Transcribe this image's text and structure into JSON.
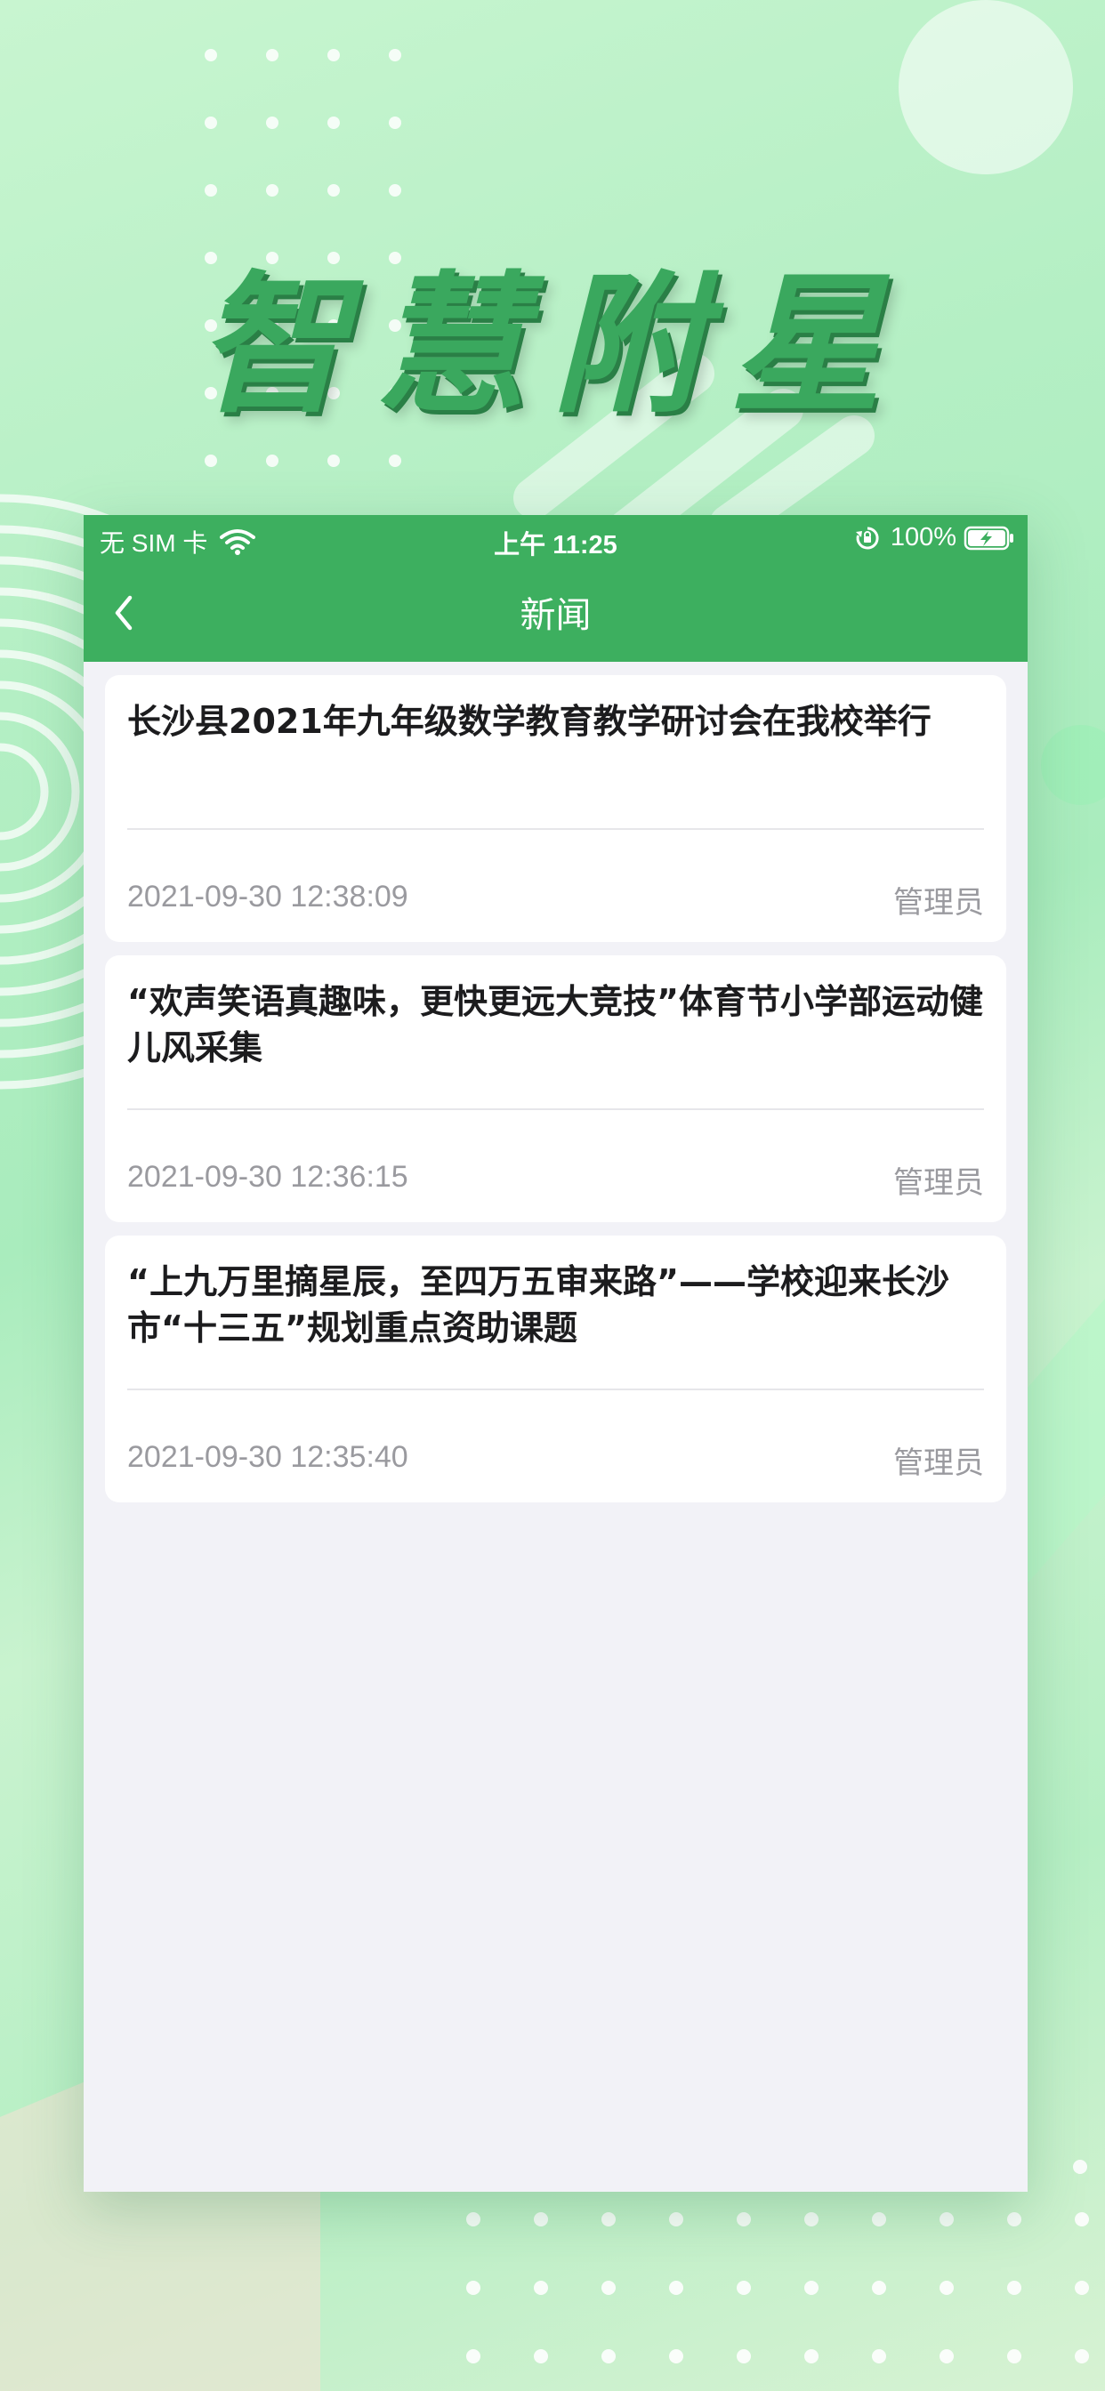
{
  "promo": {
    "title": "智慧附星"
  },
  "status_bar": {
    "carrier": "无 SIM 卡",
    "time": "上午 11:25",
    "battery": "100%"
  },
  "nav": {
    "title": "新闻"
  },
  "news": [
    {
      "title": "长沙县2021年九年级数学教育教学研讨会在我校举行",
      "date": "2021-09-30 12:38:09",
      "author": "管理员"
    },
    {
      "title": "“欢声笑语真趣味，更快更远大竞技”体育节小学部运动健儿风采集",
      "date": "2021-09-30 12:36:15",
      "author": "管理员"
    },
    {
      "title": "“上九万里摘星辰，至四万五审来路”——学校迎来长沙市“十三五”规划重点资助课题",
      "date": "2021-09-30 12:35:40",
      "author": "管理员"
    }
  ],
  "colors": {
    "header_green": "#3daf5f",
    "title_green": "#3aa85e",
    "list_bg": "#f2f2f7"
  },
  "icons": {
    "back": "chevron-left-icon",
    "wifi": "wifi-icon",
    "orientation_lock": "orientation-lock-icon",
    "battery": "battery-charging-icon"
  }
}
